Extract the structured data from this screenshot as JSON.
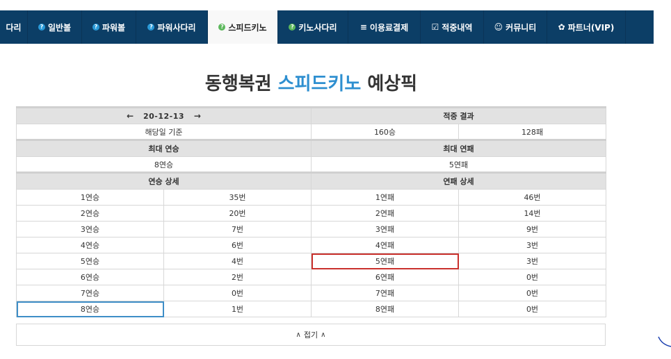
{
  "nav": {
    "items": [
      {
        "label": "다리",
        "icon": ""
      },
      {
        "label": "일반볼",
        "icon": "?"
      },
      {
        "label": "파워볼",
        "icon": "?"
      },
      {
        "label": "파워사다리",
        "icon": "?"
      },
      {
        "label": "스피드키노",
        "icon": "?"
      },
      {
        "label": "키노사다리",
        "icon": "?"
      },
      {
        "label": "이용료결제",
        "icon": "≡"
      },
      {
        "label": "적중내역",
        "icon": "☑"
      },
      {
        "label": "커뮤니티",
        "icon": "☺"
      },
      {
        "label": "파트너(VIP)",
        "icon": "✿"
      }
    ]
  },
  "title": {
    "prefix": "동행복권",
    "accent": "스피드키노",
    "suffix": "예상픽"
  },
  "summary": {
    "prev_arrow": "←",
    "next_arrow": "→",
    "date": "20-12-13",
    "hit_result_label": "적중 결과",
    "basis_label": "해당일 기준",
    "wins": "160승",
    "losses": "128패",
    "max_win_streak_label": "최대 연승",
    "max_loss_streak_label": "최대 연패",
    "max_win_streak": "8연승",
    "max_loss_streak": "5연패",
    "win_detail_label": "연승 상세",
    "loss_detail_label": "연패 상세"
  },
  "streaks": [
    {
      "win": "1연승",
      "win_count": "35번",
      "loss": "1연패",
      "loss_count": "46번"
    },
    {
      "win": "2연승",
      "win_count": "20번",
      "loss": "2연패",
      "loss_count": "14번"
    },
    {
      "win": "3연승",
      "win_count": "7번",
      "loss": "3연패",
      "loss_count": "9번"
    },
    {
      "win": "4연승",
      "win_count": "6번",
      "loss": "4연패",
      "loss_count": "3번"
    },
    {
      "win": "5연승",
      "win_count": "4번",
      "loss": "5연패",
      "loss_count": "3번"
    },
    {
      "win": "6연승",
      "win_count": "2번",
      "loss": "6연패",
      "loss_count": "0번"
    },
    {
      "win": "7연승",
      "win_count": "0번",
      "loss": "7연패",
      "loss_count": "0번"
    },
    {
      "win": "8연승",
      "win_count": "1번",
      "loss": "8연패",
      "loss_count": "0번"
    }
  ],
  "collapse": {
    "label": "접기",
    "chevron": "≈"
  },
  "colors": {
    "nav_bg": "#0c3e66",
    "accent": "#2e8fd0",
    "highlight_red": "#c9302c",
    "highlight_blue": "#3e8ec7"
  }
}
